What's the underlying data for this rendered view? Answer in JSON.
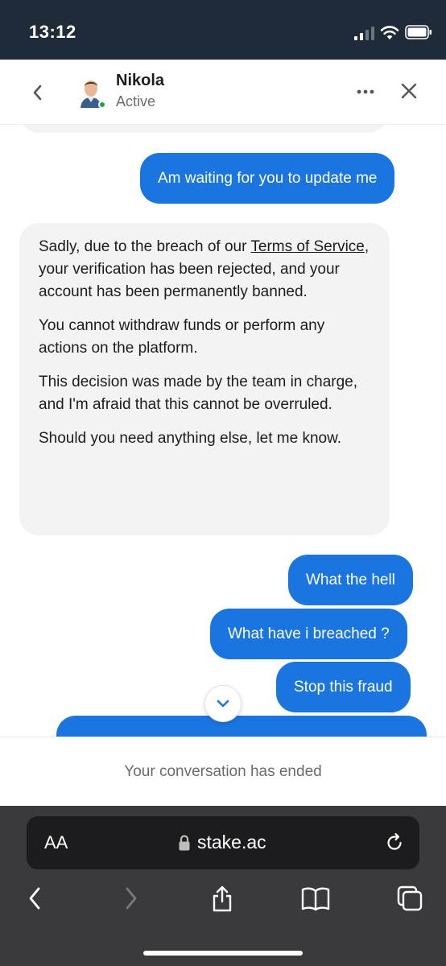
{
  "status_bar": {
    "time": "13:12"
  },
  "header": {
    "agent_name": "Nikola",
    "agent_status": "Active",
    "icons": {
      "back": "chevron-left-icon",
      "more": "more-horizontal-icon",
      "close": "close-icon"
    }
  },
  "messages": [
    {
      "direction": "outgoing",
      "text": "Am waiting for you to update me"
    },
    {
      "direction": "incoming",
      "paragraphs": [
        {
          "before": "Sadly, due to the breach of our ",
          "link": "Terms of Service",
          "after": ", your verification has been rejected, and your account has been permanently banned."
        },
        {
          "text": "You cannot withdraw funds or perform any actions on the platform."
        },
        {
          "text": "This decision was made by the team in charge, and I'm afraid that this cannot be overruled."
        },
        {
          "text": "Should you need anything else, let me know."
        }
      ]
    },
    {
      "direction": "outgoing",
      "text": "What the hell"
    },
    {
      "direction": "outgoing",
      "text": "What have i breached ?"
    },
    {
      "direction": "outgoing",
      "text": "Stop this fraud"
    }
  ],
  "footer": {
    "ended_text": "Your conversation has ended"
  },
  "browser": {
    "text_size_button": "AA",
    "url": "stake.ac",
    "toolbar": [
      "back-icon",
      "forward-icon",
      "share-icon",
      "bookmarks-icon",
      "tabs-icon"
    ]
  },
  "colors": {
    "status_bar_bg": "#1f2b38",
    "outgoing_bubble": "#1b75e0",
    "incoming_bubble": "#f3f3f4",
    "online": "#1fa53a",
    "browser_chrome": "#3a3a3c"
  }
}
